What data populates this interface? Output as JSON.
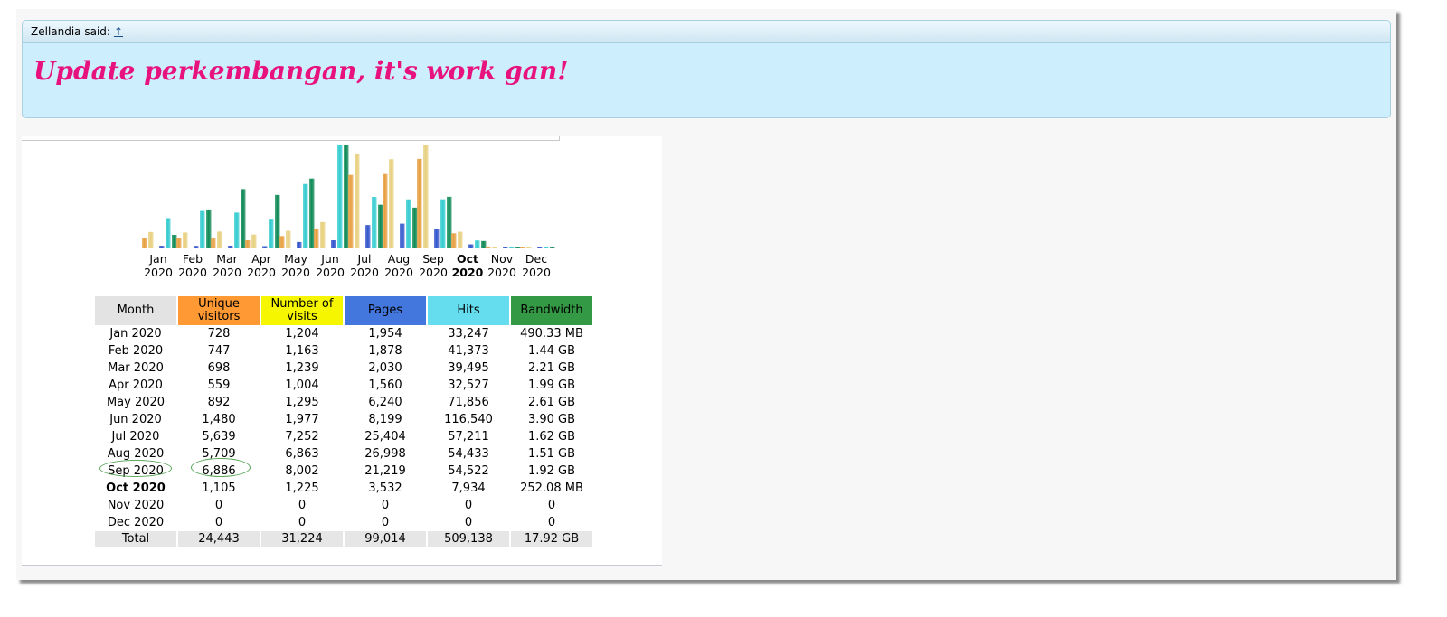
{
  "quote": {
    "author_label": "Zellandia said:",
    "link_label": "↑",
    "message": "Update perkembangan, it's work gan!"
  },
  "chart_data": {
    "type": "bar",
    "categories": [
      "Jan 2020",
      "Feb 2020",
      "Mar 2020",
      "Apr 2020",
      "May 2020",
      "Jun 2020",
      "Jul 2020",
      "Aug 2020",
      "Sep 2020",
      "Oct 2020",
      "Nov 2020",
      "Dec 2020"
    ],
    "categories_line1": [
      "Jan",
      "Feb",
      "Mar",
      "Apr",
      "May",
      "Jun",
      "Jul",
      "Aug",
      "Sep",
      "Oct",
      "Nov",
      "Dec"
    ],
    "categories_line2": [
      "2020",
      "2020",
      "2020",
      "2020",
      "2020",
      "2020",
      "2020",
      "2020",
      "2020",
      "2020",
      "2020",
      "2020"
    ],
    "current_index": 9,
    "series": [
      {
        "name": "Unique visitors",
        "values": [
          728,
          747,
          698,
          559,
          892,
          1480,
          5639,
          5709,
          6886,
          1105,
          0,
          0
        ]
      },
      {
        "name": "Number of visits",
        "values": [
          1204,
          1163,
          1239,
          1004,
          1295,
          1977,
          7252,
          6863,
          8002,
          1225,
          0,
          0
        ]
      },
      {
        "name": "Pages",
        "values": [
          1954,
          1878,
          2030,
          1560,
          6240,
          8199,
          25404,
          26998,
          21219,
          3532,
          0,
          0
        ]
      },
      {
        "name": "Hits",
        "values": [
          33247,
          41373,
          39495,
          32527,
          71856,
          116540,
          57211,
          54433,
          54522,
          7934,
          0,
          0
        ]
      },
      {
        "name": "Bandwidth",
        "values": [
          0.479,
          1.44,
          2.21,
          1.99,
          2.61,
          3.9,
          1.62,
          1.51,
          1.92,
          0.246,
          0,
          0
        ]
      }
    ],
    "colors": {
      "unique": "#e8a042",
      "visits": "#e8d080",
      "pages": "#3355cc",
      "hits": "#33ccd0",
      "bandwidth": "#0f8a55"
    }
  },
  "table": {
    "headers": [
      "Month",
      "Unique visitors",
      "Number of visits",
      "Pages",
      "Hits",
      "Bandwidth"
    ],
    "rows": [
      [
        "Jan 2020",
        "728",
        "1,204",
        "1,954",
        "33,247",
        "490.33 MB"
      ],
      [
        "Feb 2020",
        "747",
        "1,163",
        "1,878",
        "41,373",
        "1.44 GB"
      ],
      [
        "Mar 2020",
        "698",
        "1,239",
        "2,030",
        "39,495",
        "2.21 GB"
      ],
      [
        "Apr 2020",
        "559",
        "1,004",
        "1,560",
        "32,527",
        "1.99 GB"
      ],
      [
        "May 2020",
        "892",
        "1,295",
        "6,240",
        "71,856",
        "2.61 GB"
      ],
      [
        "Jun 2020",
        "1,480",
        "1,977",
        "8,199",
        "116,540",
        "3.90 GB"
      ],
      [
        "Jul 2020",
        "5,639",
        "7,252",
        "25,404",
        "57,211",
        "1.62 GB"
      ],
      [
        "Aug 2020",
        "5,709",
        "6,863",
        "26,998",
        "54,433",
        "1.51 GB"
      ],
      [
        "Sep 2020",
        "6,886",
        "8,002",
        "21,219",
        "54,522",
        "1.92 GB"
      ],
      [
        "Oct 2020",
        "1,105",
        "1,225",
        "3,532",
        "7,934",
        "252.08 MB"
      ],
      [
        "Nov 2020",
        "0",
        "0",
        "0",
        "0",
        "0"
      ],
      [
        "Dec 2020",
        "0",
        "0",
        "0",
        "0",
        "0"
      ]
    ],
    "total": [
      "Total",
      "24,443",
      "31,224",
      "99,014",
      "509,138",
      "17.92 GB"
    ]
  }
}
